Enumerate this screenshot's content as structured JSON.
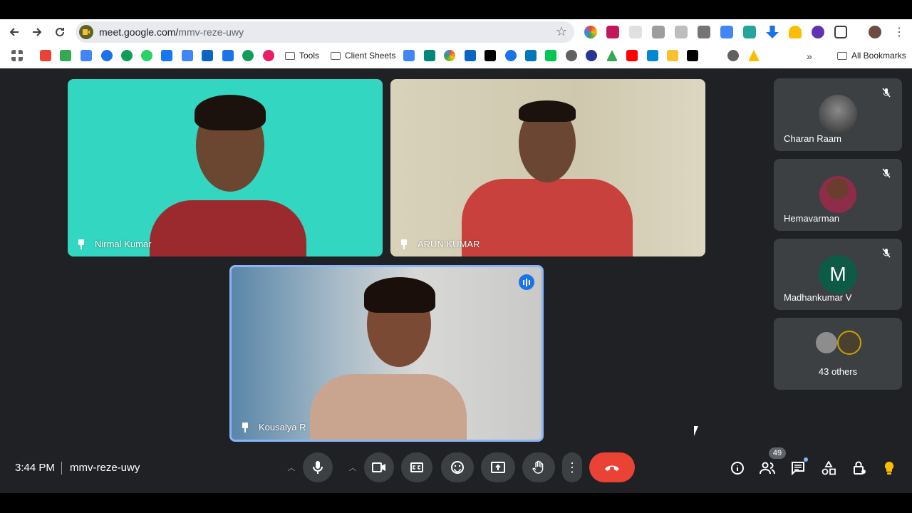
{
  "browser": {
    "url_host": "meet.google.com/",
    "url_path": "mmv-reze-uwy",
    "bookmarks": {
      "tools": "Tools",
      "client_sheets": "Client Sheets",
      "all_bookmarks": "All Bookmarks"
    }
  },
  "tiles": [
    {
      "name": "Nirmal Kumar"
    },
    {
      "name": "ARUN KUMAR"
    },
    {
      "name": "Kousalya R"
    }
  ],
  "side": [
    {
      "name": "Charan Raam"
    },
    {
      "name": "Hemavarman"
    },
    {
      "name": "Madhankumar V",
      "initial": "M"
    },
    {
      "others": "43 others"
    }
  ],
  "bar": {
    "time": "3:44 PM",
    "meeting_code": "mmv-reze-uwy",
    "participant_count": "49"
  },
  "colors": {
    "end_call": "#ea4335",
    "stage": "#202124",
    "active_speaker": "#8ab4f8"
  }
}
